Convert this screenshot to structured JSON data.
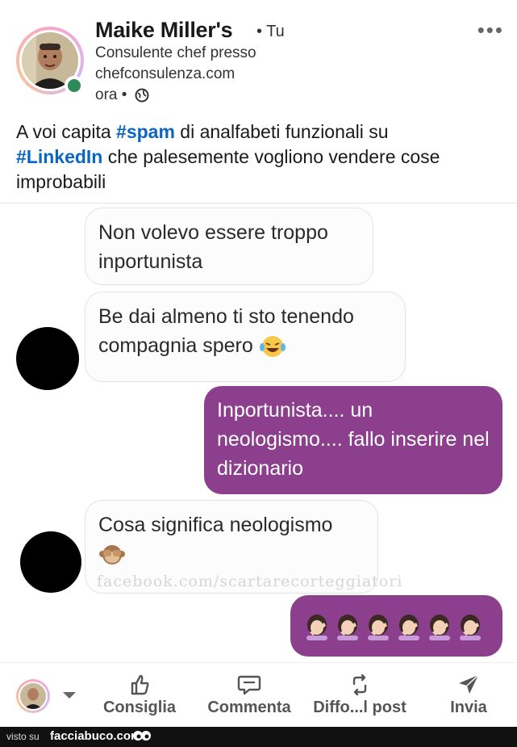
{
  "post": {
    "author": "Maike Miller's",
    "you": "• Tu",
    "headline_1": "Consulente chef presso",
    "headline_2": "chefconsulenza.com",
    "time": "ora •",
    "text_1": "A voi capita ",
    "hashtag_1": "#spam",
    "text_2": " di analfabeti funzionali su ",
    "hashtag_2": "#LinkedIn",
    "text_3": " che palesemente vogliono vendere cose improbabili"
  },
  "chat": {
    "messages": [
      {
        "side": "in",
        "text": "Non volevo essere troppo inportunista"
      },
      {
        "side": "in",
        "text": "Be dai almeno ti sto tenendo compagnia spero",
        "emoji": "laughing-tears"
      },
      {
        "side": "out",
        "text": "Inportunista.... un neologismo.... fallo inserire nel dizionario"
      },
      {
        "side": "in",
        "text": "Cosa significa neologismo",
        "emoji": "see-no-evil-monkey"
      },
      {
        "side": "out",
        "text": "",
        "emoji": "facepalm-woman x6"
      }
    ],
    "watermark": "facebook.com/scartarecorteggiatori"
  },
  "actions": {
    "like": "Consiglia",
    "comment": "Commenta",
    "share": "Diffo...l post",
    "send": "Invia"
  },
  "footer": {
    "visto": "visto su",
    "site": "facciabuco.com"
  },
  "colors": {
    "hashtag": "#0a66c2",
    "outgoing_bubble": "#8b3f8c",
    "online": "#2e8b57"
  }
}
